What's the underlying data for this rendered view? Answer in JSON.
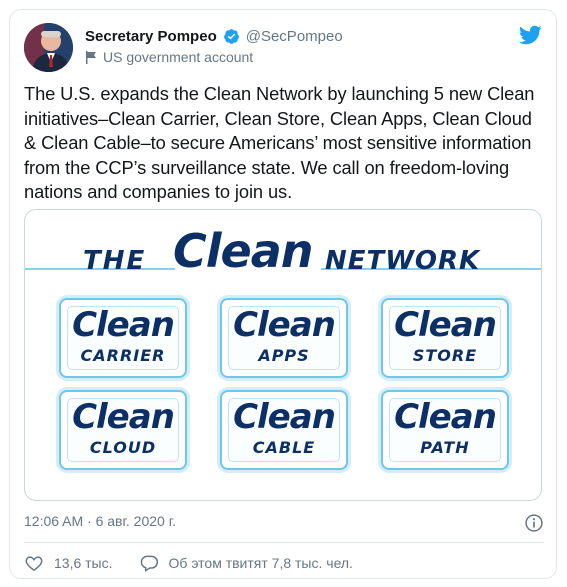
{
  "tweet": {
    "display_name": "Secretary Pompeo",
    "handle": "@SecPompeo",
    "account_label": "US government account",
    "text": "The U.S. expands the Clean Network by launching 5 new Clean initiatives–Clean Carrier, Clean Store, Clean Apps, Clean Cloud & Clean Cable–to secure Americans’ most sensitive information from the CCP’s surveillance state. We call on freedom-loving nations and companies to join us.",
    "timestamp": "12:06 AM · 6 авг. 2020 г.",
    "likes": "13,6 тыс.",
    "talking_about": "Об этом твитят 7,8 тыс. чел.",
    "icons": {
      "verified": "verified-badge-icon",
      "bird": "twitter-bird-icon",
      "flag": "flag-icon",
      "info": "info-icon",
      "heart": "heart-icon",
      "comment": "comment-icon"
    },
    "colors": {
      "verified_blue": "#1da1f2",
      "brand_navy": "#0c2f66",
      "accent_light_blue": "#6fc7ea",
      "text_secondary": "#657786"
    }
  },
  "media": {
    "logo": {
      "the": "THE",
      "clean": "Clean",
      "network": "NETWORK"
    },
    "badges": [
      {
        "word": "Clean",
        "sub": "CARRIER"
      },
      {
        "word": "Clean",
        "sub": "APPS"
      },
      {
        "word": "Clean",
        "sub": "STORE"
      },
      {
        "word": "Clean",
        "sub": "CLOUD"
      },
      {
        "word": "Clean",
        "sub": "CABLE"
      },
      {
        "word": "Clean",
        "sub": "PATH"
      }
    ]
  }
}
